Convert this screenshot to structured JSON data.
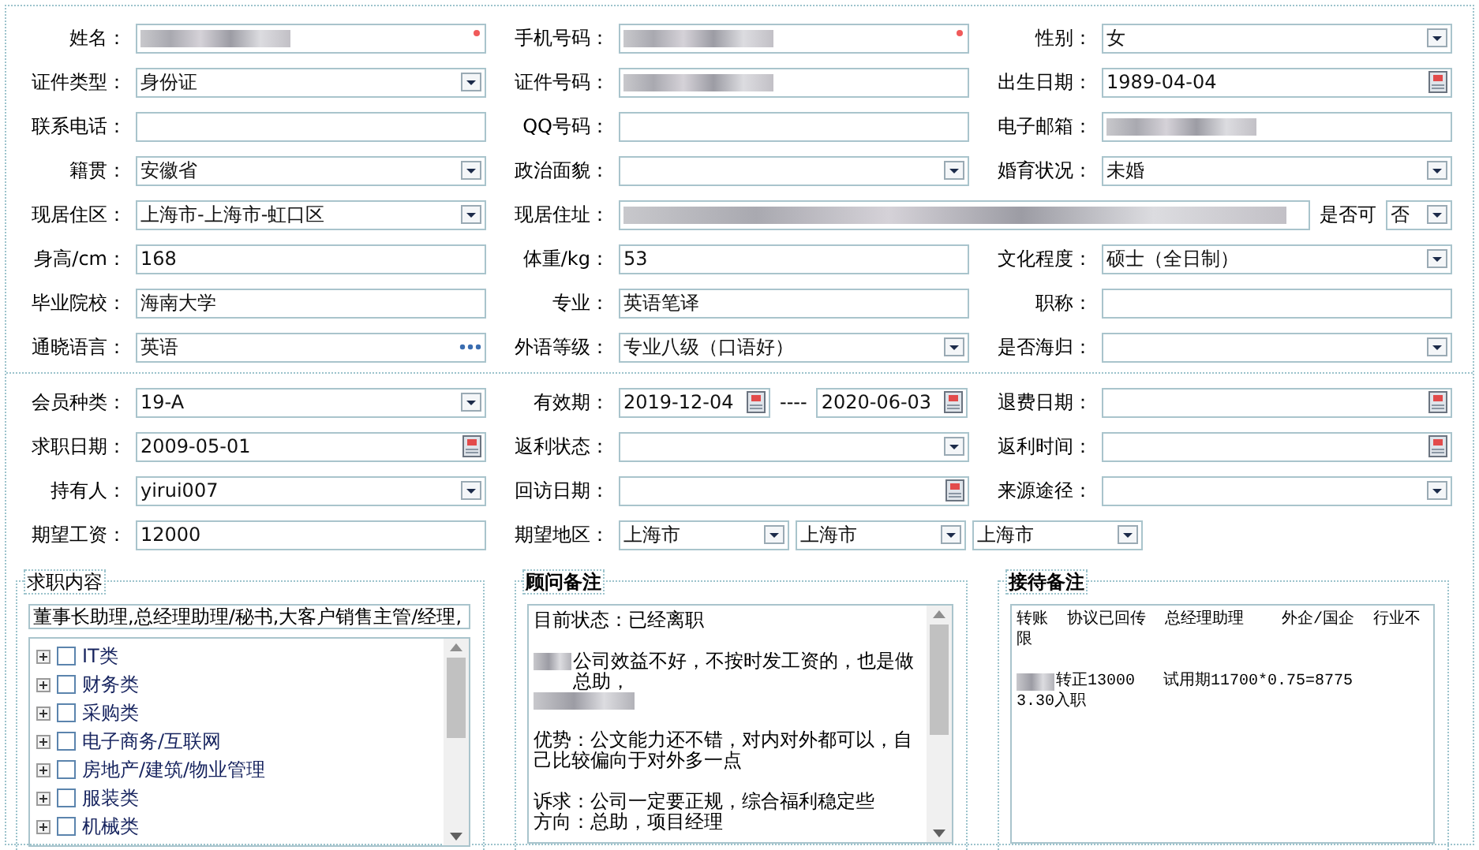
{
  "sections": [
    {
      "fields": [
        {
          "label": "姓名：",
          "kind": "text",
          "redacted": true,
          "required": true
        },
        {
          "label": "手机号码：",
          "kind": "text",
          "redacted": true,
          "required": true
        },
        {
          "label": "性别：",
          "kind": "select",
          "value": "女"
        },
        {
          "label": "证件类型：",
          "kind": "select",
          "value": "身份证"
        },
        {
          "label": "证件号码：",
          "kind": "text",
          "redacted": true
        },
        {
          "label": "出生日期：",
          "kind": "date",
          "value": "1989-04-04"
        },
        {
          "label": "联系电话：",
          "kind": "text"
        },
        {
          "label": "QQ号码：",
          "kind": "text"
        },
        {
          "label": "电子邮箱：",
          "kind": "text",
          "redacted": true
        },
        {
          "label": "籍贯：",
          "kind": "select",
          "value": "安徽省"
        },
        {
          "label": "政治面貌：",
          "kind": "select"
        },
        {
          "label": "婚育状况：",
          "kind": "select",
          "value": "未婚"
        },
        {
          "label": "现居住区：",
          "kind": "select",
          "value": "上海市-上海市-虹口区"
        },
        {
          "label": "现居住址：",
          "kind": "text",
          "redacted": true,
          "extra": {
            "label": "是否可",
            "value": "否"
          }
        },
        {
          "label": "身高/cm：",
          "kind": "text",
          "value": "168"
        },
        {
          "label": "体重/kg：",
          "kind": "text",
          "value": "53"
        },
        {
          "label": "文化程度：",
          "kind": "select",
          "value": "硕士（全日制）"
        },
        {
          "label": "毕业院校：",
          "kind": "text",
          "value": "海南大学"
        },
        {
          "label": "专业：",
          "kind": "text",
          "value": "英语笔译"
        },
        {
          "label": "职称：",
          "kind": "text"
        },
        {
          "label": "通晓语言：",
          "kind": "lookup",
          "value": "英语"
        },
        {
          "label": "外语等级：",
          "kind": "select",
          "value": "专业八级（口语好）"
        },
        {
          "label": "是否海归：",
          "kind": "select"
        }
      ]
    },
    {
      "fields": [
        {
          "label": "会员种类：",
          "kind": "select",
          "value": "19-A"
        },
        {
          "label": "有效期：",
          "kind": "date_range",
          "values": [
            "2019-12-04",
            "2020-06-03"
          ],
          "separator": "----"
        },
        {
          "label": "退费日期：",
          "kind": "date"
        },
        {
          "label": "求职日期：",
          "kind": "date",
          "value": "2009-05-01"
        },
        {
          "label": "返利状态：",
          "kind": "select"
        },
        {
          "label": "返利时间：",
          "kind": "date"
        },
        {
          "label": "持有人：",
          "kind": "select",
          "value": "yirui007"
        },
        {
          "label": "回访日期：",
          "kind": "date"
        },
        {
          "label": "来源途径：",
          "kind": "select"
        },
        {
          "label": "期望工资：",
          "kind": "text",
          "value": "12000"
        },
        {
          "label": "期望地区：",
          "kind": "multi_select",
          "values": [
            "上海市",
            "上海市",
            "上海市"
          ]
        }
      ]
    }
  ],
  "groups": [
    {
      "kind": "tree",
      "title": "求职内容",
      "bold": false,
      "summary": "董事长助理,总经理助理/秘书,大客户销售主管/经理,",
      "scrollable": true,
      "items": [
        {
          "label": "IT类",
          "checked": false,
          "expanded": false
        },
        {
          "label": "财务类",
          "checked": false,
          "expanded": false
        },
        {
          "label": "采购类",
          "checked": false,
          "expanded": false
        },
        {
          "label": "电子商务/互联网",
          "checked": false,
          "expanded": false
        },
        {
          "label": "房地产/建筑/物业管理",
          "checked": false,
          "expanded": false
        },
        {
          "label": "服装类",
          "checked": false,
          "expanded": false
        },
        {
          "label": "机械类",
          "checked": false,
          "expanded": false
        }
      ]
    },
    {
      "kind": "notes",
      "title": "顾问备注",
      "bold": true,
      "scrollable": true,
      "paragraphs": [
        {
          "lines": [
            "目前状态：已经离职"
          ]
        },
        {
          "redacted_before": true,
          "redacted_after": true,
          "lines": [
            "公司效益不好，不按时发工资的，也是做总助，"
          ]
        },
        {
          "lines": [
            "优势：公文能力还不错，对内对外都可以，自己比较偏向于对外多一点"
          ]
        },
        {
          "lines": [
            "诉求：公司一定要正规，综合福利稳定些",
            "方向：总助，项目经理"
          ]
        }
      ]
    },
    {
      "kind": "notes",
      "title": "接待备注",
      "bold": true,
      "scrollable": false,
      "paragraphs": [
        {
          "lines": [
            "转账  协议已回传  总经理助理    外企/国企  行业不限"
          ]
        },
        {
          "redacted_before": true,
          "lines": [
            "转正13000   试用期11700*0.75=8775",
            "3.30入职"
          ]
        }
      ]
    }
  ]
}
